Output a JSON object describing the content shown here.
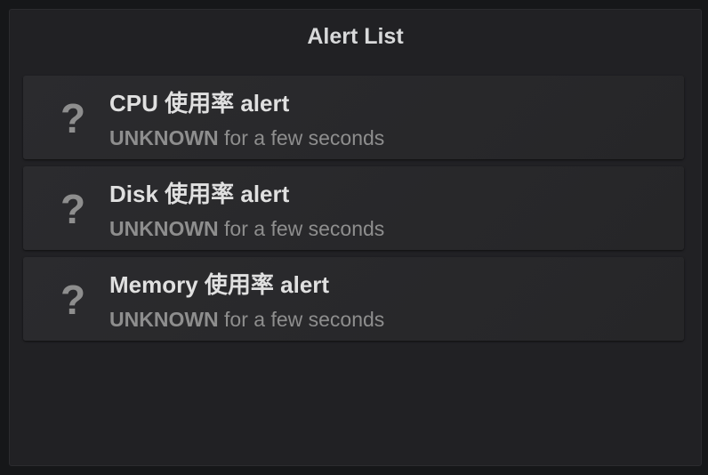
{
  "panel": {
    "title": "Alert List"
  },
  "alerts": [
    {
      "icon": "question-icon",
      "icon_glyph": "?",
      "name": "CPU 使用率 alert",
      "state": "UNKNOWN",
      "age": " for a few seconds"
    },
    {
      "icon": "question-icon",
      "icon_glyph": "?",
      "name": "Disk 使用率 alert",
      "state": "UNKNOWN",
      "age": " for a few seconds"
    },
    {
      "icon": "question-icon",
      "icon_glyph": "?",
      "name": "Memory 使用率 alert",
      "state": "UNKNOWN",
      "age": " for a few seconds"
    }
  ],
  "colors": {
    "background": "#161719",
    "panel": "#212124",
    "unknown_state": "#8e8e8e"
  }
}
